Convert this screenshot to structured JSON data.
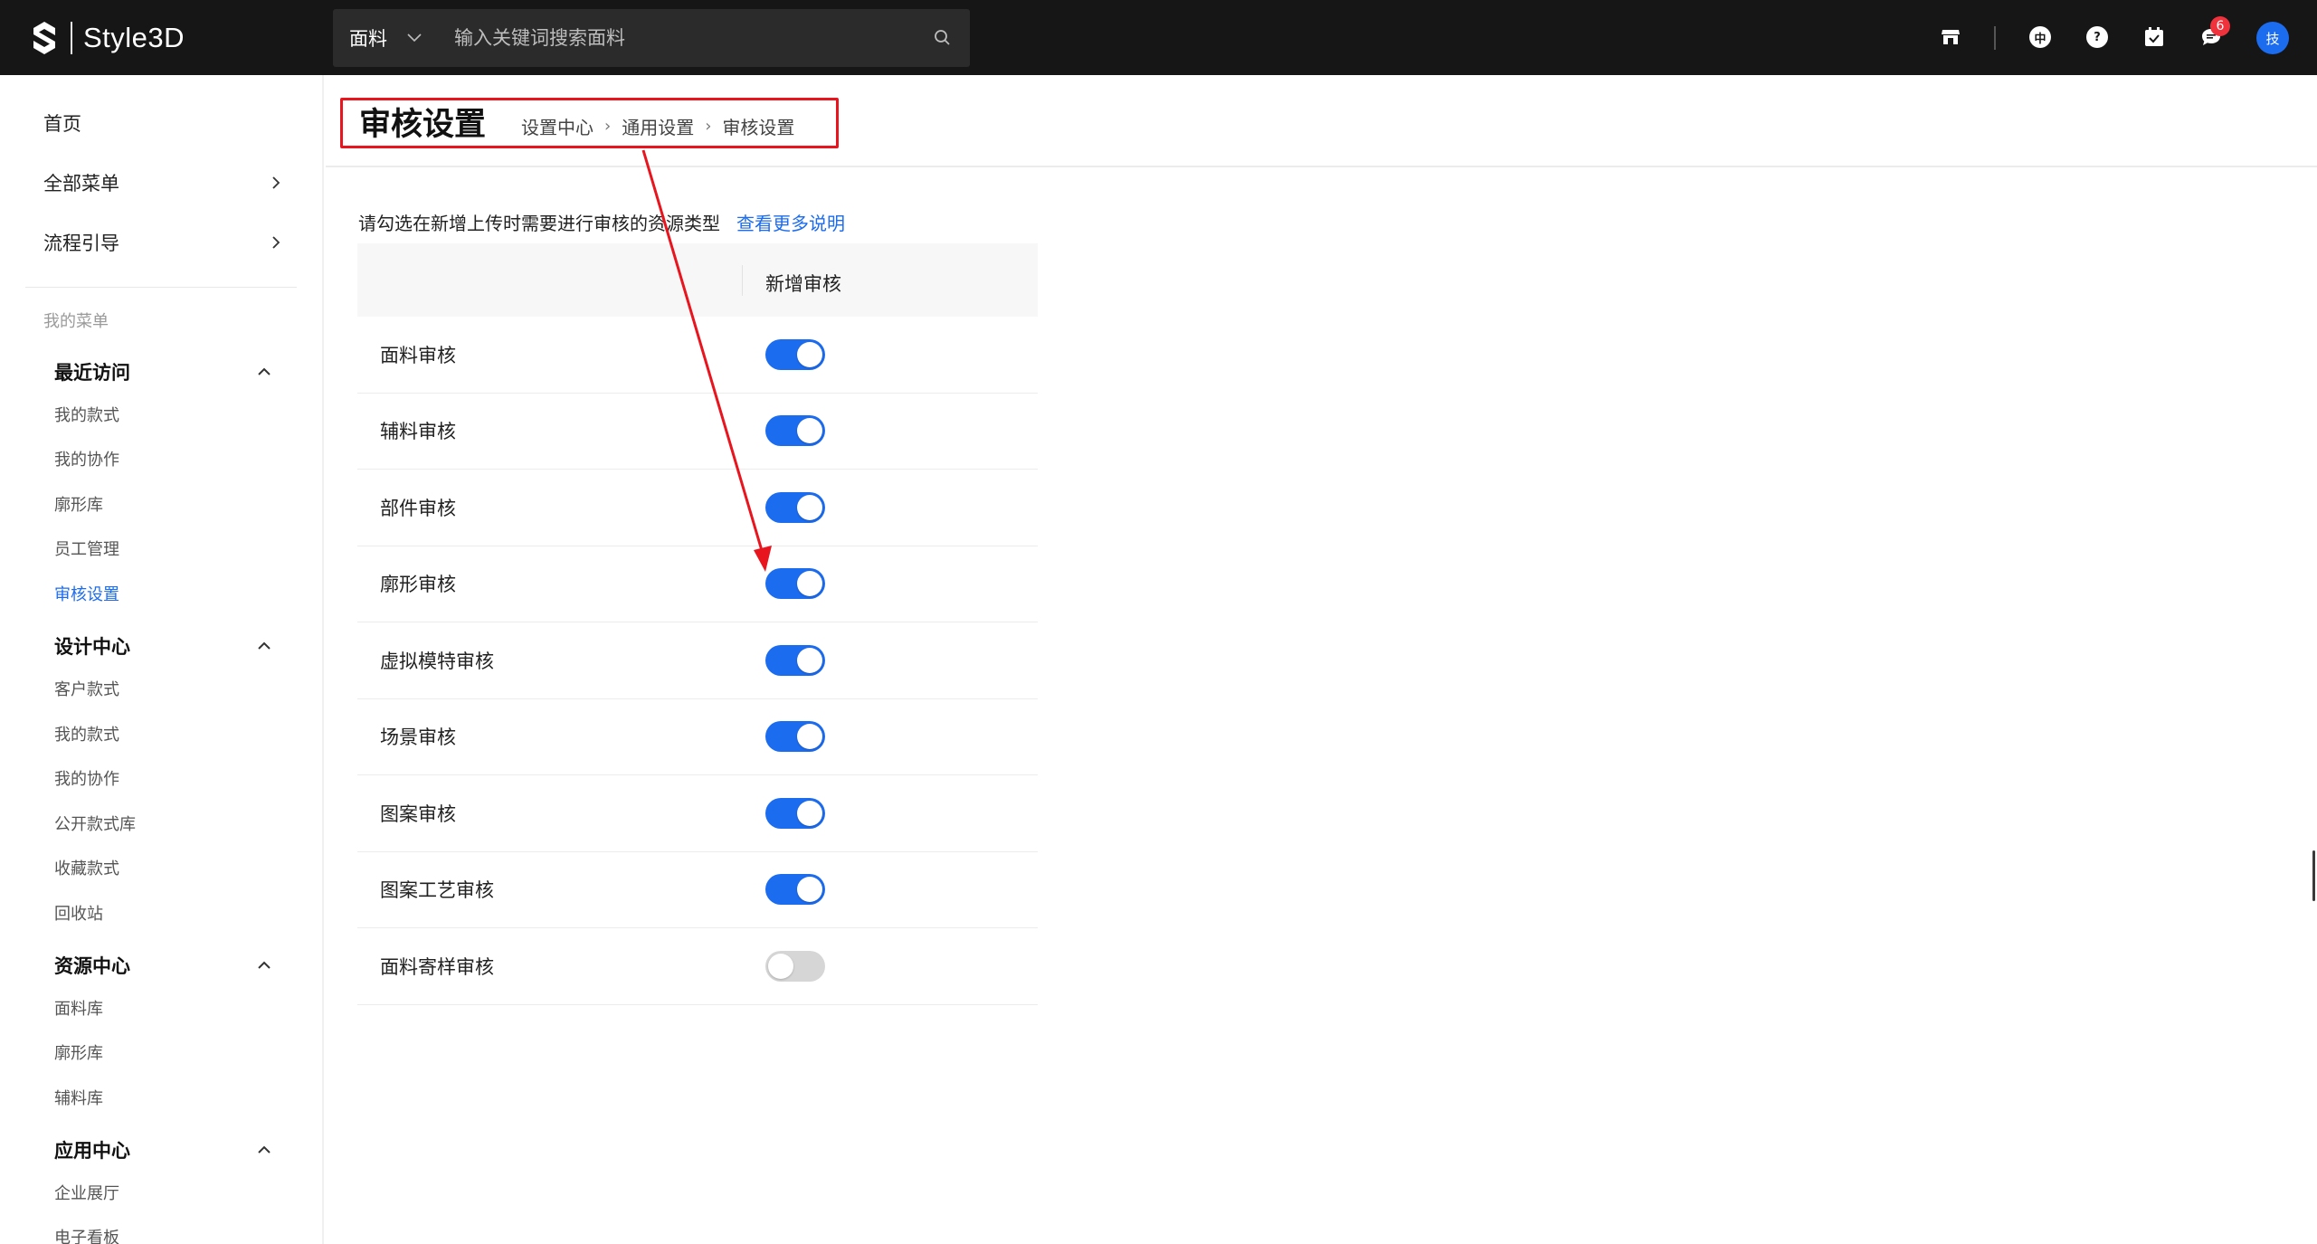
{
  "app": {
    "brand": "Style3D"
  },
  "topbar": {
    "search": {
      "category": "面料",
      "placeholder": "输入关键词搜索面料"
    },
    "language_glyph": "中",
    "help_glyph": "?",
    "message_badge": "6",
    "avatar_text": "技",
    "icons": [
      "store-icon",
      "language-icon",
      "help-icon",
      "calendar-check-icon",
      "message-icon"
    ]
  },
  "sidebar": {
    "top_items": [
      {
        "label": "首页"
      },
      {
        "label": "全部菜单"
      },
      {
        "label": "流程引导"
      }
    ],
    "section_caption": "我的菜单",
    "groups": [
      {
        "title": "最近访问",
        "items": [
          "我的款式",
          "我的协作",
          "廓形库",
          "员工管理",
          "审核设置"
        ]
      },
      {
        "title": "设计中心",
        "items": [
          "客户款式",
          "我的款式",
          "我的协作",
          "公开款式库",
          "收藏款式",
          "回收站"
        ]
      },
      {
        "title": "资源中心",
        "items": [
          "面料库",
          "廓形库",
          "辅料库"
        ]
      },
      {
        "title": "应用中心",
        "items": [
          "企业展厅",
          "电子看板"
        ]
      }
    ],
    "active_item": "审核设置"
  },
  "page": {
    "title": "审核设置",
    "breadcrumb": [
      "设置中心",
      "通用设置",
      "审核设置"
    ],
    "intro": "请勾选在新增上传时需要进行审核的资源类型",
    "intro_link": "查看更多说明",
    "table": {
      "column_header": "新增审核",
      "rows": [
        {
          "name": "面料审核",
          "enabled": true
        },
        {
          "name": "辅料审核",
          "enabled": true
        },
        {
          "name": "部件审核",
          "enabled": true
        },
        {
          "name": "廓形审核",
          "enabled": true
        },
        {
          "name": "虚拟模特审核",
          "enabled": true
        },
        {
          "name": "场景审核",
          "enabled": true
        },
        {
          "name": "图案审核",
          "enabled": true
        },
        {
          "name": "图案工艺审核",
          "enabled": true
        },
        {
          "name": "面料寄样审核",
          "enabled": false
        }
      ]
    }
  },
  "colors": {
    "topbar_bg": "#161616",
    "accent": "#1c6cf0",
    "annotation": "#e8141e",
    "badge": "#f0323c",
    "toggle_off": "#d6d6d6"
  }
}
